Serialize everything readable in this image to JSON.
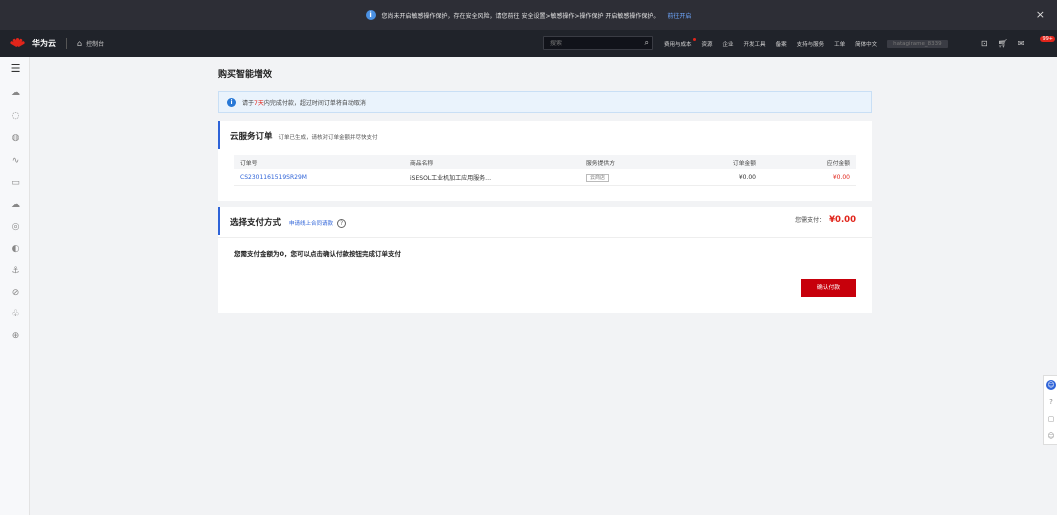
{
  "banner": {
    "message": "您尚未开启敏感操作保护，存在安全风险，请您前往 安全设置>敏感操作>操作保护 开启敏感操作保护。",
    "link": "前往开启",
    "close": "×"
  },
  "topnav": {
    "brand": "华为云",
    "console": "控制台",
    "search_placeholder": "搜索",
    "links": [
      "费用与成本",
      "资源",
      "企业",
      "开发工具",
      "备案",
      "支持与服务",
      "工单",
      "简体中文"
    ],
    "account": "hatagirame_8339",
    "badge": "99+"
  },
  "page": {
    "title": "购买智能增效"
  },
  "notice": {
    "prefix": "请于",
    "days": "7天",
    "suffix": "内完成付款，超过时间订单将自动取消"
  },
  "order_card": {
    "title": "云服务订单",
    "subtitle": "订单已生成，请核对订单金额并尽快支付",
    "columns": [
      "订单号",
      "商品名称",
      "服务提供方",
      "订单金额",
      "应付金额"
    ],
    "rows": [
      {
        "order_no": "CS2301161519SR29M",
        "product": "iSESOL工业机加工应用服务…",
        "provider": "云商店",
        "amount": "¥0.00",
        "payable": "¥0.00"
      }
    ]
  },
  "payment_card": {
    "title": "选择支付方式",
    "apply_link": "申请线上合同请款",
    "help": "?",
    "need_pay_label": "您需支付：",
    "need_pay_amount": "¥0.00",
    "zero_message": "您需支付金额为0，您可以点击确认付款按钮完成订单支付",
    "confirm_button": "确认付款"
  },
  "colors": {
    "accent_red": "#c7000b",
    "link_blue": "#2e63d8",
    "nav_bg": "#20232a"
  }
}
